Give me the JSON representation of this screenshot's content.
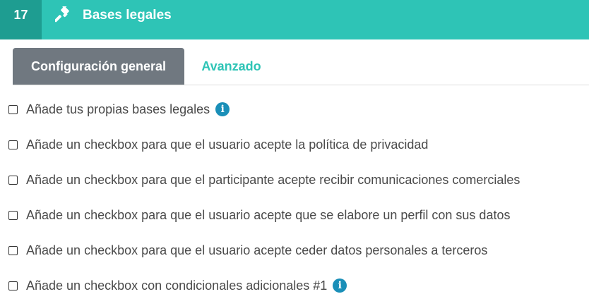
{
  "header": {
    "step_number": "17",
    "title": "Bases legales",
    "icon": "gavel-icon",
    "bg_color": "#2ec4b6",
    "step_bg_color": "#1e9d91"
  },
  "tabs": [
    {
      "label": "Configuración general",
      "active": true
    },
    {
      "label": "Avanzado",
      "active": false
    }
  ],
  "options": [
    {
      "label": "Añade tus propias bases legales",
      "info": true,
      "checked": false
    },
    {
      "label": "Añade un checkbox para que el usuario acepte la política de privacidad",
      "info": false,
      "checked": false
    },
    {
      "label": "Añade un checkbox para que el participante acepte recibir comunicaciones comerciales",
      "info": false,
      "checked": false
    },
    {
      "label": "Añade un checkbox para que el usuario acepte que se elabore un perfil con sus datos",
      "info": false,
      "checked": false
    },
    {
      "label": "Añade un checkbox para que el usuario acepte ceder datos personales a terceros",
      "info": false,
      "checked": false
    },
    {
      "label": "Añade un checkbox con condicionales adicionales #1",
      "info": true,
      "checked": false
    }
  ],
  "info_glyph": "i"
}
